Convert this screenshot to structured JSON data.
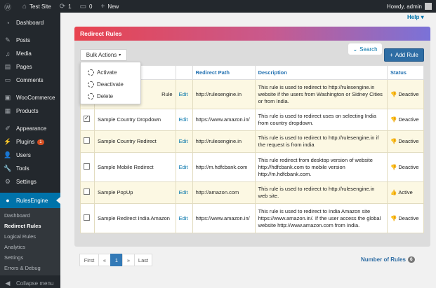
{
  "adminbar": {
    "site_name": "Test Site",
    "updates_count": "1",
    "comments_count": "0",
    "new_label": "New",
    "howdy": "Howdy, admin"
  },
  "sidebar": {
    "items": [
      {
        "label": "Dashboard",
        "icon": "dashboard-icon"
      },
      {
        "label": "Posts",
        "icon": "pin-icon"
      },
      {
        "label": "Media",
        "icon": "media-icon"
      },
      {
        "label": "Pages",
        "icon": "page-icon"
      },
      {
        "label": "Comments",
        "icon": "comment-icon"
      },
      {
        "label": "WooCommerce",
        "icon": "woocommerce-icon"
      },
      {
        "label": "Products",
        "icon": "box-icon"
      },
      {
        "label": "Appearance",
        "icon": "brush-icon"
      },
      {
        "label": "Plugins",
        "icon": "plugin-icon",
        "badge": "1"
      },
      {
        "label": "Users",
        "icon": "user-icon"
      },
      {
        "label": "Tools",
        "icon": "wrench-icon"
      },
      {
        "label": "Settings",
        "icon": "settings-icon"
      },
      {
        "label": "RulesEngine",
        "icon": "rulesengine-icon"
      }
    ],
    "submenu": [
      "Dashboard",
      "Redirect Rules",
      "Logical Rules",
      "Analytics",
      "Settings",
      "Errors & Debug"
    ],
    "collapse_label": "Collapse menu"
  },
  "help_label": "Help",
  "panel": {
    "title": "Redirect Rules",
    "bulk_actions_label": "Bulk Actions",
    "search_label": "Search",
    "add_rule_label": "Add Rule",
    "bulk_menu": [
      "Activate",
      "Deactivate",
      "Delete"
    ]
  },
  "table": {
    "headers": [
      "Redirect Path",
      "Description",
      "Status"
    ],
    "edit_label": "Edit",
    "rows": [
      {
        "name": "Rule",
        "path": "http://rulesengine.in",
        "desc": "This rule is used to redirect to http://rulesengine.in website if the users from Washington or Sidney Cities or from India.",
        "status": "Deactive",
        "checked": false
      },
      {
        "name": "Sample Country Dropdown",
        "path": "https://www.amazon.in/",
        "desc": "This rule is used to redirect uses on selecting India from country dropdown.",
        "status": "Deactive",
        "checked": true
      },
      {
        "name": "Sample Country Redirect",
        "path": "http://rulesengine.in",
        "desc": "This rule is used to redirect to http://rulesengine.in if the request is from india",
        "status": "Deactive",
        "checked": false
      },
      {
        "name": "Sample Mobile Redirect",
        "path": "http://m.hdfcbank.com",
        "desc": "This rule redirect from desktop version of website http://hdfcbank.com to mobile version http://m.hdfcbank.com.",
        "status": "Deactive",
        "checked": false
      },
      {
        "name": "Sample PopUp",
        "path": "http://amazon.com",
        "desc": "This rule is used to redirect to http://rulesengine.in web site.",
        "status": "Active",
        "checked": false
      },
      {
        "name": "Sample Redirect India Amazon",
        "path": "https://www.amazon.in/",
        "desc": "This rule is used to redirect to India Amazon site https://www.amazon.in/. If the user access the global website http://www.amazon.com from India.",
        "status": "Deactive",
        "checked": false
      }
    ]
  },
  "pagination": {
    "first": "First",
    "prev": "«",
    "current": "1",
    "next": "»",
    "last": "Last"
  },
  "number_of_rules": {
    "label": "Number of Rules",
    "count": "6"
  }
}
